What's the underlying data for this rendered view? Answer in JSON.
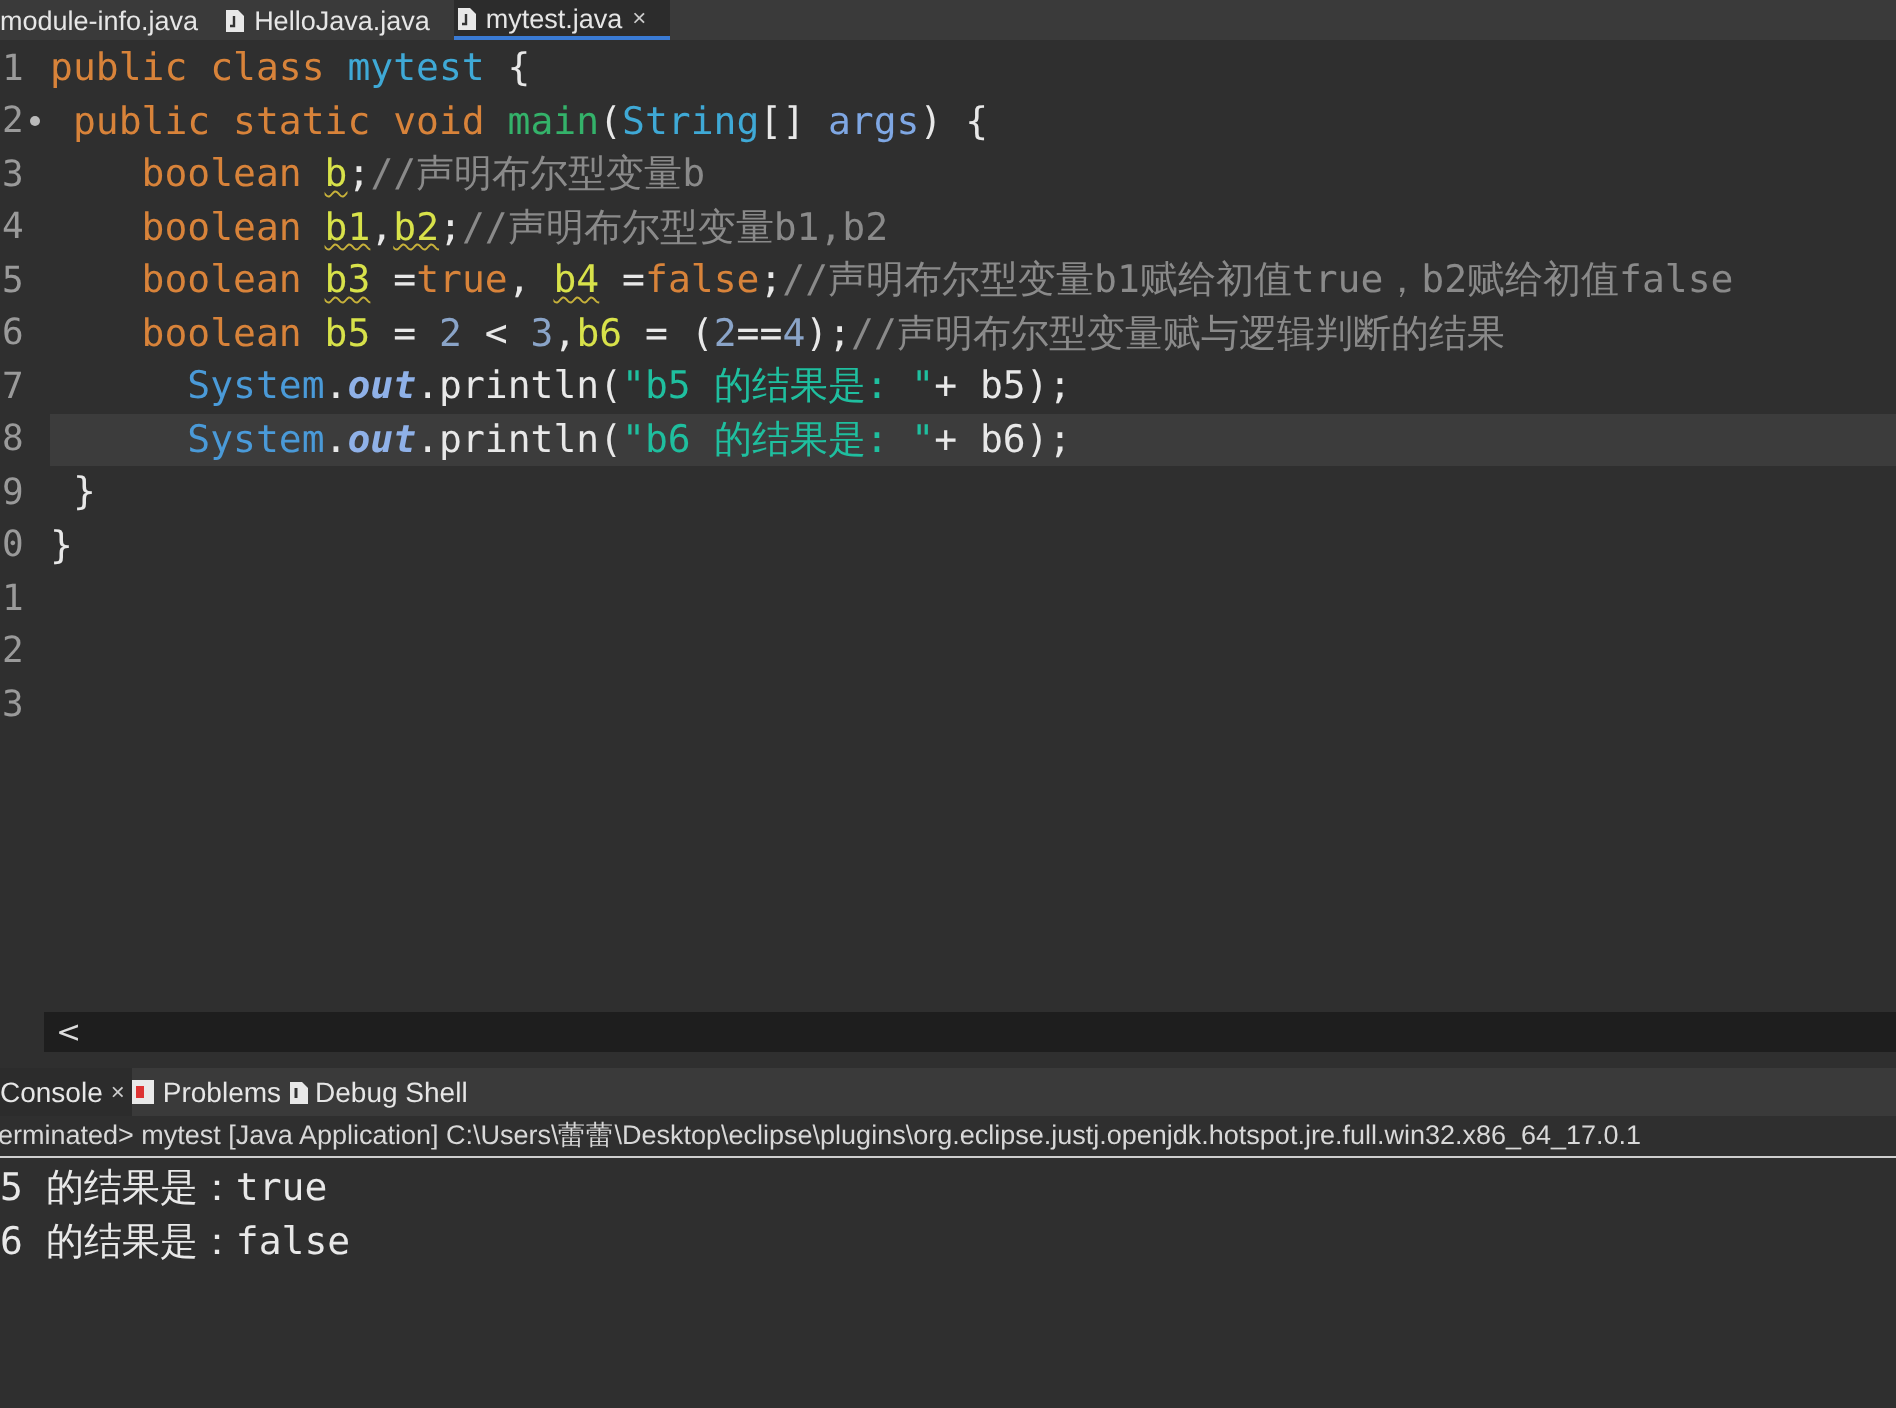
{
  "editor_tabs": [
    {
      "label": "module-info.java",
      "selected": false,
      "kind": "plain"
    },
    {
      "label": "HelloJava.java",
      "selected": false,
      "kind": "java"
    },
    {
      "label": "mytest.java",
      "selected": true,
      "kind": "java",
      "close": "×"
    }
  ],
  "code_lines": [
    {
      "number": "1",
      "fold_marker": false,
      "selected": false,
      "tokens": [
        {
          "kind": "kw",
          "text": "public class "
        },
        {
          "kind": "cls",
          "text": "mytest"
        },
        {
          "kind": "plain",
          "text": " {"
        }
      ]
    },
    {
      "number": "2",
      "fold_marker": true,
      "selected": false,
      "tokens": [
        {
          "kind": "kw",
          "text": " public static void "
        },
        {
          "kind": "method",
          "text": "main"
        },
        {
          "kind": "plain",
          "text": "("
        },
        {
          "kind": "cls",
          "text": "String"
        },
        {
          "kind": "plain",
          "text": "[] "
        },
        {
          "kind": "param",
          "text": "args"
        },
        {
          "kind": "plain",
          "text": ") {"
        }
      ]
    },
    {
      "number": "3",
      "fold_marker": false,
      "selected": false,
      "tokens": [
        {
          "kind": "kw",
          "text": "    boolean "
        },
        {
          "kind": "warn",
          "text": "b"
        },
        {
          "kind": "plain",
          "text": ";"
        },
        {
          "kind": "comment",
          "text": "//声明布尔型变量b"
        }
      ]
    },
    {
      "number": "4",
      "fold_marker": false,
      "selected": false,
      "tokens": [
        {
          "kind": "kw",
          "text": "    boolean "
        },
        {
          "kind": "warn",
          "text": "b1"
        },
        {
          "kind": "plain",
          "text": ","
        },
        {
          "kind": "warn",
          "text": "b2"
        },
        {
          "kind": "plain",
          "text": ";"
        },
        {
          "kind": "comment",
          "text": "//声明布尔型变量b1,b2"
        }
      ]
    },
    {
      "number": "5",
      "fold_marker": false,
      "selected": false,
      "tokens": [
        {
          "kind": "kw",
          "text": "    boolean "
        },
        {
          "kind": "warn",
          "text": "b3"
        },
        {
          "kind": "plain",
          "text": " ="
        },
        {
          "kind": "kw",
          "text": "true"
        },
        {
          "kind": "plain",
          "text": ", "
        },
        {
          "kind": "warn",
          "text": "b4"
        },
        {
          "kind": "plain",
          "text": " ="
        },
        {
          "kind": "kw",
          "text": "false"
        },
        {
          "kind": "plain",
          "text": ";"
        },
        {
          "kind": "comment",
          "text": "//声明布尔型变量b1赋给初值true，b2赋给初值false"
        }
      ]
    },
    {
      "number": "6",
      "fold_marker": false,
      "selected": false,
      "tokens": [
        {
          "kind": "kw",
          "text": "    boolean "
        },
        {
          "kind": "var",
          "text": "b5"
        },
        {
          "kind": "plain",
          "text": " = "
        },
        {
          "kind": "num",
          "text": "2"
        },
        {
          "kind": "plain",
          "text": " < "
        },
        {
          "kind": "num",
          "text": "3"
        },
        {
          "kind": "plain",
          "text": ","
        },
        {
          "kind": "var",
          "text": "b6"
        },
        {
          "kind": "plain",
          "text": " = ("
        },
        {
          "kind": "num",
          "text": "2"
        },
        {
          "kind": "plain",
          "text": "=="
        },
        {
          "kind": "num",
          "text": "4"
        },
        {
          "kind": "plain",
          "text": ");"
        },
        {
          "kind": "comment",
          "text": "//声明布尔型变量赋与逻辑判断的结果"
        }
      ]
    },
    {
      "number": "7",
      "fold_marker": false,
      "selected": false,
      "tokens": [
        {
          "kind": "sys",
          "text": "      System"
        },
        {
          "kind": "plain",
          "text": "."
        },
        {
          "kind": "field",
          "text": "out"
        },
        {
          "kind": "plain",
          "text": ".println("
        },
        {
          "kind": "str",
          "text": "\"b5 的结果是: \""
        },
        {
          "kind": "plain",
          "text": "+ b5);"
        }
      ]
    },
    {
      "number": "8",
      "fold_marker": false,
      "selected": true,
      "tokens": [
        {
          "kind": "sys",
          "text": "      System"
        },
        {
          "kind": "plain",
          "text": "."
        },
        {
          "kind": "field",
          "text": "out"
        },
        {
          "kind": "plain",
          "text": ".println("
        },
        {
          "kind": "str",
          "text": "\"b6 的结果是: \""
        },
        {
          "kind": "plain",
          "text": "+ b6);"
        }
      ]
    },
    {
      "number": "9",
      "fold_marker": false,
      "selected": false,
      "tokens": [
        {
          "kind": "plain",
          "text": " }"
        }
      ]
    },
    {
      "number": "0",
      "fold_marker": false,
      "selected": false,
      "tokens": [
        {
          "kind": "plain",
          "text": "}"
        }
      ]
    },
    {
      "number": "1",
      "fold_marker": false,
      "selected": false
    },
    {
      "number": "2",
      "fold_marker": false,
      "selected": false
    },
    {
      "number": "3",
      "fold_marker": false,
      "selected": false
    }
  ],
  "scrollbar": {
    "arrow": "<"
  },
  "console_tabs": [
    {
      "label": "Console",
      "selected": true,
      "kind": "console",
      "close": "×"
    },
    {
      "label": "Problems",
      "selected": false,
      "kind": "problems"
    },
    {
      "label": "Debug Shell",
      "selected": false,
      "kind": "debug"
    }
  ],
  "console_status": "erminated> mytest [Java Application] C:\\Users\\蕾蕾\\Desktop\\eclipse\\plugins\\org.eclipse.justj.openjdk.hotspot.jre.full.win32.x86_64_17.0.1",
  "console_output": [
    "5 的结果是：true",
    "6 的结果是：false"
  ]
}
